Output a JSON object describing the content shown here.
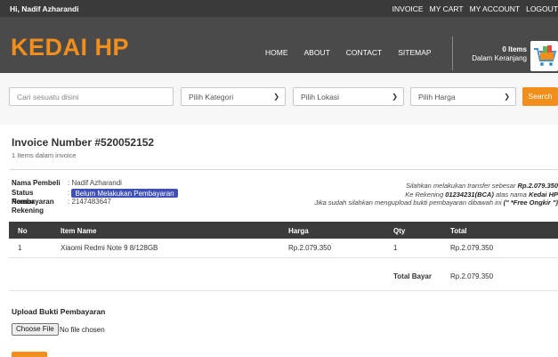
{
  "topbar": {
    "greeting": "Hi, Nadif Azharandi",
    "links": [
      "INVOICE",
      "MY CART",
      "MY ACCOUNT",
      "LOGOUT"
    ]
  },
  "header": {
    "logo": "KEDAI HP",
    "nav": [
      "HOME",
      "ABOUT",
      "CONTACT",
      "SITEMAP"
    ],
    "cart_count": "0 Items",
    "cart_label": "Dalam Keranjang"
  },
  "search": {
    "placeholder": "Cari sesuatu disini",
    "category": "Pilih Kategori",
    "location": "Pilih Lokasi",
    "price": "Pilih Harga",
    "button": "Search"
  },
  "invoice": {
    "title": "Invoice Number #520052152",
    "subtitle": "1 Items dalam invoice",
    "buyer_label": "Nama Pembeli",
    "buyer_value": ": Nadif Azharandi",
    "status_label": "Status Pembayaran",
    "status_value": "Belum Melakukan Pembayaran",
    "account_label": "Nomor Rekening",
    "account_value": ": 2147483647",
    "note_1a": "Silahkan melakukan transfer sebesar ",
    "note_1b": "Rp.2.079.350",
    "note_2a": "Ke Rekening ",
    "note_2b": "01234231(BCA)",
    "note_2c": " atas nama ",
    "note_2d": "Kedai HP",
    "note_3a": "Jika sudah silahkan mengupload bukti pembayaran dibawah ini ",
    "note_3b": "(\" *Free Ongkir \")"
  },
  "table": {
    "headers": [
      "No",
      "Item Name",
      "Harga",
      "Qty",
      "Total"
    ],
    "rows": [
      [
        "1",
        "Xiaomi Redmi Note 9 8/128GB",
        "Rp.2.079.350",
        "1",
        "Rp.2.079.350"
      ]
    ],
    "total_label": "Total Bayar",
    "total_value": "Rp.2.079.350"
  },
  "upload": {
    "title": "Upload Bukti Pembayaran",
    "button": "Choose File",
    "status": "No file chosen"
  },
  "colors": {
    "accent": "#f28e1c",
    "badge": "#3f51b5",
    "dark": "#3b3b3b"
  }
}
